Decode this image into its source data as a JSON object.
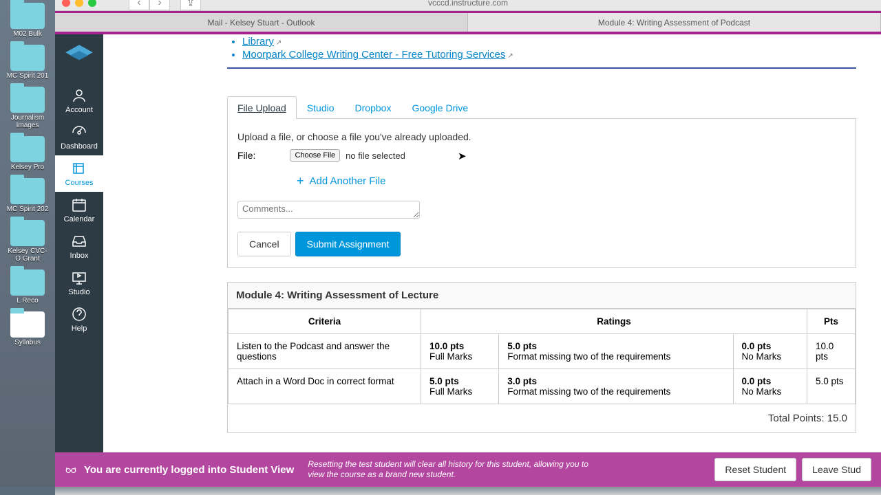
{
  "browser": {
    "address": "vcccd.instructure.com",
    "tabs": [
      "Mail - Kelsey Stuart - Outlook",
      "Module 4: Writing Assessment of Podcast"
    ]
  },
  "desktop_folders": [
    "M02 Bulk",
    "MC Spirit 201",
    "Journalism Images",
    "Kelsey Pro",
    "MC Spirit 202",
    "Kelsey CVC-O Grant",
    "L Reco",
    "Syllabus"
  ],
  "sidebar": {
    "items": [
      {
        "label": "Account"
      },
      {
        "label": "Dashboard"
      },
      {
        "label": "Courses"
      },
      {
        "label": "Calendar"
      },
      {
        "label": "Inbox"
      },
      {
        "label": "Studio"
      },
      {
        "label": "Help"
      }
    ]
  },
  "links": {
    "library": "Library",
    "writing_center": "Moorpark College Writing Center - Free Tutoring Services"
  },
  "submission": {
    "tabs": [
      "File Upload",
      "Studio",
      "Dropbox",
      "Google Drive"
    ],
    "intro": "Upload a file, or choose a file you've already uploaded.",
    "file_label": "File:",
    "choose_file": "Choose File",
    "no_file": "no file selected",
    "add_another": "Add Another File",
    "comments_placeholder": "Comments...",
    "cancel": "Cancel",
    "submit": "Submit Assignment"
  },
  "rubric": {
    "title": "Module 4: Writing Assessment of Lecture",
    "headers": {
      "criteria": "Criteria",
      "ratings": "Ratings",
      "pts": "Pts"
    },
    "rows": [
      {
        "criteria": "Listen to the Podcast and answer the questions",
        "ratings": [
          {
            "pts": "10.0 pts",
            "desc": "Full Marks"
          },
          {
            "pts": "5.0 pts",
            "desc": "Format missing two of the requirements"
          },
          {
            "pts": "0.0 pts",
            "desc": "No Marks"
          }
        ],
        "pts": "10.0 pts"
      },
      {
        "criteria": "Attach in a Word Doc in correct format",
        "ratings": [
          {
            "pts": "5.0 pts",
            "desc": "Full Marks"
          },
          {
            "pts": "3.0 pts",
            "desc": "Format missing two of the requirements"
          },
          {
            "pts": "0.0 pts",
            "desc": "No Marks"
          }
        ],
        "pts": "5.0 pts"
      }
    ],
    "total": "Total Points: 15.0"
  },
  "student_view": {
    "label": "You are currently logged into Student View",
    "msg": "Resetting the test student will clear all history for this student, allowing you to view the course as a brand new student.",
    "reset": "Reset Student",
    "leave": "Leave Stud"
  }
}
